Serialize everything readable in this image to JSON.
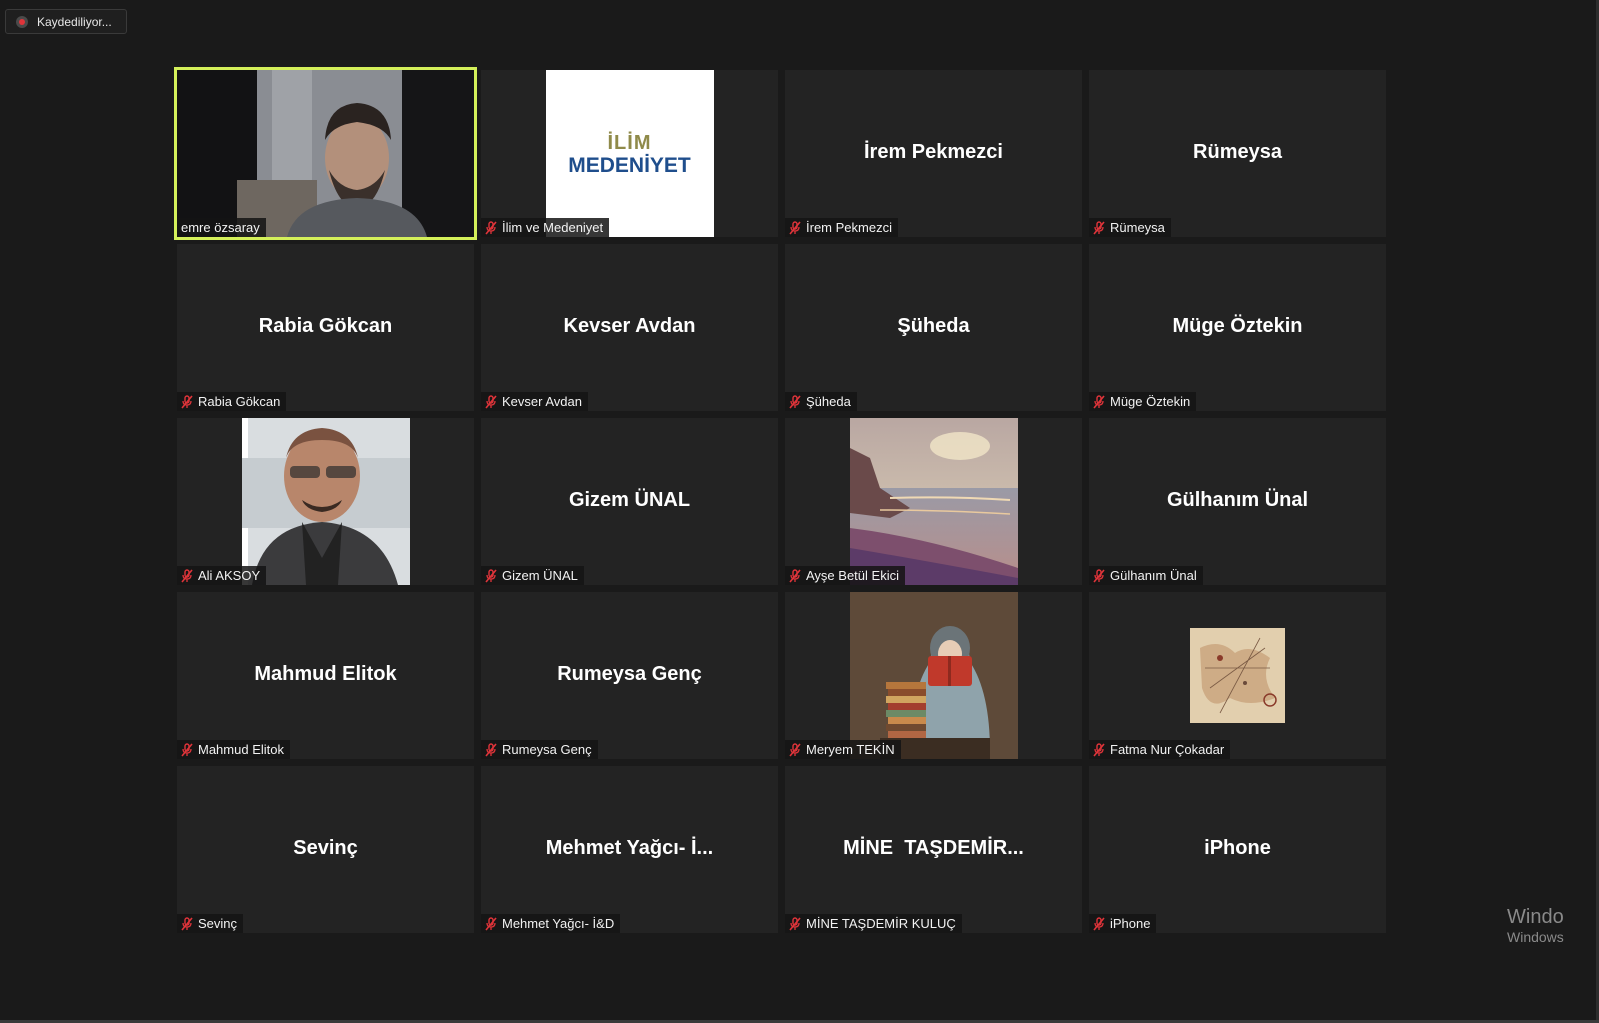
{
  "recording": {
    "label": "Kaydediliyor..."
  },
  "tiles": [
    {
      "label": "emre özsaray",
      "type": "video"
    },
    {
      "label": "İlim ve Medeniyet",
      "type": "logo",
      "logo_top": "İLİM",
      "logo_bottom": "MEDENİYET"
    },
    {
      "label": "İrem Pekmezci",
      "big": "İrem Pekmezci"
    },
    {
      "label": "Rümeysa",
      "big": "Rümeysa"
    },
    {
      "label": "Rabia Gökcan",
      "big": "Rabia Gökcan"
    },
    {
      "label": "Kevser Avdan",
      "big": "Kevser Avdan"
    },
    {
      "label": "Şüheda",
      "big": "Şüheda"
    },
    {
      "label": "Müge Öztekin",
      "big": "Müge Öztekin"
    },
    {
      "label": "Ali AKSOY",
      "type": "photo"
    },
    {
      "label": "Gizem ÜNAL",
      "big": "Gizem ÜNAL"
    },
    {
      "label": "Ayşe Betül Ekici",
      "type": "painting"
    },
    {
      "label": "Gülhanım Ünal",
      "big": "Gülhanım Ünal"
    },
    {
      "label": "Mahmud Elitok",
      "big": "Mahmud Elitok"
    },
    {
      "label": "Rumeysa Genç",
      "big": "Rumeysa Genç"
    },
    {
      "label": "Meryem TEKİN",
      "type": "illustration"
    },
    {
      "label": "Fatma Nur Çokadar",
      "type": "map"
    },
    {
      "label": "Sevinç",
      "big": "Sevinç"
    },
    {
      "label": "Mehmet Yağcı- İ&D",
      "big": "Mehmet Yağcı- İ..."
    },
    {
      "label": "MİNE TAŞDEMİR KULUÇ",
      "big": "MİNE  TAŞDEMİR..."
    },
    {
      "label": "iPhone",
      "big": "iPhone"
    }
  ],
  "watermark": {
    "line1": "Windo",
    "line2": "Windows"
  },
  "colors": {
    "active_speaker_border": "#d4f05a",
    "muted_mic": "#e0343a",
    "tile_bg": "#232323"
  },
  "icons": {
    "muted": "mic-muted-icon",
    "recording": "record-dot-icon"
  }
}
